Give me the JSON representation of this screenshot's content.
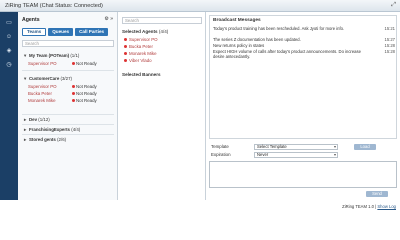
{
  "window": {
    "title": "ZiRing TEAM (Chat Status: Connected)",
    "expand_icon": "expand-icon"
  },
  "rail": {
    "icons": [
      "chat-icon",
      "people-icon",
      "megaphone-icon",
      "history-icon"
    ]
  },
  "agents": {
    "header": "Agents",
    "tabs": [
      "Teams",
      "Queues",
      "Call Parties"
    ],
    "search_placeholder": "Search",
    "groups": [
      {
        "label": "My Team (POTeam)",
        "count": "(1/1)",
        "expanded": true,
        "members": [
          {
            "name": "Supervisor PO",
            "status": "Not Ready"
          }
        ]
      },
      {
        "label": "CustomerCare",
        "count": "(3/27)",
        "expanded": true,
        "members": [
          {
            "name": "Supervisor PO",
            "status": "Not Ready"
          },
          {
            "name": "Bucka Peter",
            "status": "Not Ready"
          },
          {
            "name": "Monarek Mike",
            "status": "Not Ready"
          }
        ]
      },
      {
        "label": "Dev",
        "count": "(1/12)",
        "expanded": false
      },
      {
        "label": "FranchisingExperts",
        "count": "(4/4)",
        "expanded": false
      },
      {
        "label": "Stored gents",
        "count": "(2/6)",
        "expanded": false
      }
    ]
  },
  "recipients": {
    "search_placeholder": "Search",
    "selected_agents_label": "Selected Agents",
    "selected_agents_count": "(4/4)",
    "selected_agents": [
      "Supervisor PO",
      "Bucka Peter",
      "Monarek Mike",
      "Viber Vlado"
    ],
    "selected_banners_label": "Selected Banners"
  },
  "broadcast": {
    "title": "Broadcast Messages",
    "messages": [
      {
        "text": "Today's product training has been rescheduled. Ask Jyoti for more info.",
        "time": "15:21"
      },
      {
        "text": "The series Z documentation has been updated.",
        "time": "15:27"
      },
      {
        "text": "New returns policy in states",
        "time": "15:28"
      },
      {
        "text": "Expect HIGH volume of calls after today's product announcements. Do increase desire antecedantly.",
        "time": "15:28"
      }
    ],
    "template_label": "Template",
    "template_value": "Select Template",
    "load_label": "Load",
    "expiration_label": "Expiration",
    "expiration_value": "Never",
    "send_label": "Send"
  },
  "footer": {
    "text": "ZiRing TEAM 1.0 |",
    "link": "Show Log"
  },
  "colors": {
    "rail": "#1b3f66",
    "tab": "#2f74b5",
    "status_dot": "#dd3333",
    "agent_name": "#b03a3a"
  }
}
